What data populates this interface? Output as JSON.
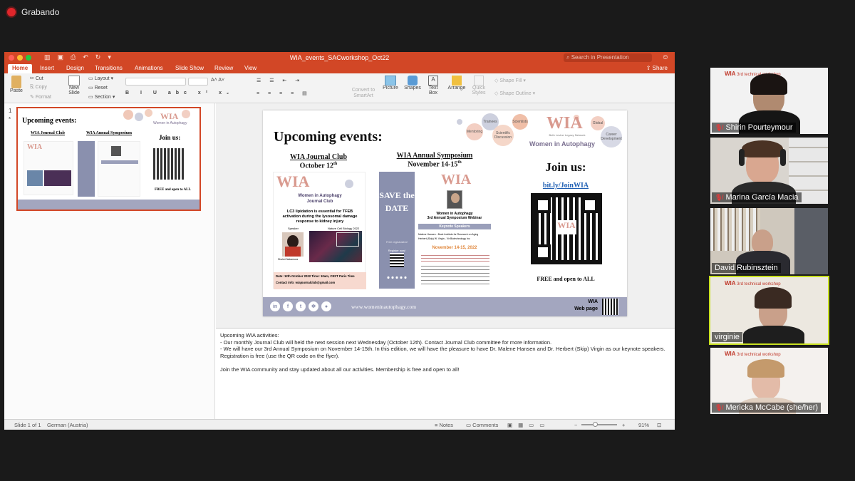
{
  "recording": {
    "label": "Grabando"
  },
  "window": {
    "title": "WIA_events_SACworkshop_Oct22",
    "search_placeholder": "Search in Presentation",
    "share": "Share"
  },
  "tabs": [
    "Home",
    "Insert",
    "Design",
    "Transitions",
    "Animations",
    "Slide Show",
    "Review",
    "View"
  ],
  "ribbon": {
    "paste": "Paste",
    "cut": "Cut",
    "copy": "Copy",
    "format": "Format",
    "new_slide": "New Slide",
    "layout": "Layout",
    "reset": "Reset",
    "section": "Section",
    "convert": "Convert to SmartArt",
    "picture": "Picture",
    "shapes": "Shapes",
    "text_box": "Text Box",
    "arrange": "Arrange",
    "quick_styles": "Quick Styles",
    "shape_fill": "Shape Fill",
    "shape_outline": "Shape Outline"
  },
  "thumb": {
    "number": "1",
    "star": "*"
  },
  "slide": {
    "title": "Upcoming events:",
    "bubbles": [
      "Trainees",
      "Mentoring",
      "Scientific Discussion",
      "Scientists",
      "Global",
      "Career Development"
    ],
    "logo": "WIA",
    "logo_sub": "Beth Levine Legacy Network",
    "logo_name": "Women in Autophagy",
    "jc_title": "WIA Journal Club",
    "jc_date": "October 12",
    "jc_sup": "th",
    "sym_title": "WIA Annual Symposium",
    "sym_date": "November 14-15",
    "sym_sup": "th",
    "join": "Join us:",
    "link": "bit.ly/JoinWIA",
    "free": "FREE and open to ALL",
    "jc_flyer": {
      "logo": "WIA",
      "name": "Women in Autophagy",
      "sub": "Journal Club",
      "talk": "LC3 lipidation is essential for TFEB activation during the lysosomal damage response to kidney injury",
      "speaker": "Speaker",
      "journal": "Nature Cell Biology 2022",
      "person": "Shuhei Nakamura",
      "date_line": "Date:  12th October 2022   Time: 10am, CEST Paris Time",
      "contact": "Contact info: wiajournalclub@gmail.com"
    },
    "save_date": "SAVE the DATE",
    "free_reg": "Free registration!",
    "register": "Register now!",
    "sym_flyer": {
      "name": "Women in Autophagy",
      "sub": "3rd Annual Symposium Webinar",
      "keynote": "Keynote Speakers",
      "k1": "Malene Hansen - Buck Institute for Research on Aging",
      "k2": "Herbert (Skip) W. Virgin - Vir Biotechnology Inc",
      "dates": "November 14-15, 2022"
    },
    "footer_url": "www.womeninautophagy.com",
    "web1": "WIA",
    "web2": "Web page",
    "social": [
      "in",
      "f",
      "t",
      "✻",
      "●"
    ]
  },
  "notes": {
    "lines": [
      "Upcoming WIA activities:",
      "- Our monthly Journal Club will held the next session next Wednesday (October 12th). Contact Journal Club committee for more information.",
      "- We will have our 3rd Annual Symposium on November 14-15th. In this edition, we will have the pleasure to have Dr. Malene Hansen and Dr. Herbert (Skip) Virgin as our keynote speakers.",
      "Registration is free (use the QR code on the flyer).",
      "",
      "Join the WIA community and stay updated about all our activities. Membership is free and open to all!"
    ]
  },
  "status": {
    "slide": "Slide 1 of 1",
    "lang": "German (Austria)",
    "notes": "Notes",
    "comments": "Comments",
    "zoom": "91%"
  },
  "participants": [
    {
      "name": "Shirin Pourteymour",
      "muted": true,
      "banner": "3rd technical workshop"
    },
    {
      "name": "Marina García Macia",
      "muted": true,
      "banner": ""
    },
    {
      "name": "David Rubinsztein",
      "muted": false,
      "banner": ""
    },
    {
      "name": "virginie",
      "muted": false,
      "banner": "3rd technical workshop",
      "active": true
    },
    {
      "name": "Mericka McCabe (she/her)",
      "muted": true,
      "banner": "3rd technical workshop"
    }
  ],
  "colors": {
    "accent": "#d24726",
    "active_speaker": "#c8e020",
    "footer": "#a3a6bf"
  }
}
